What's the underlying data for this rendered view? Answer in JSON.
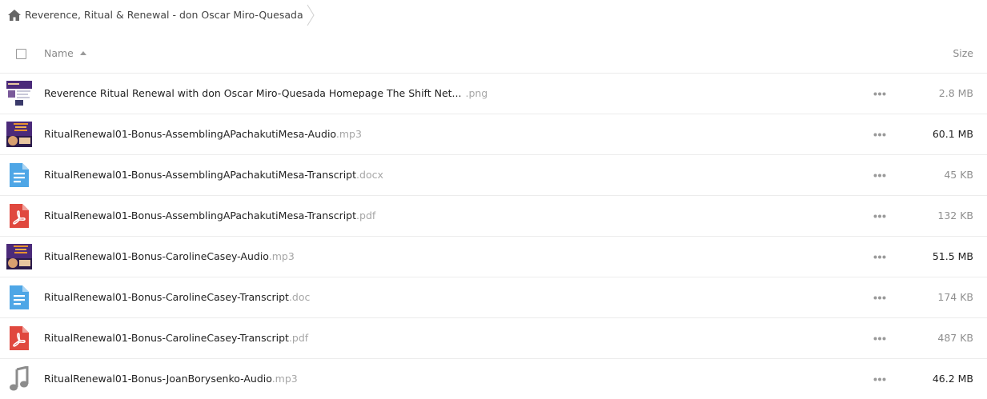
{
  "breadcrumb": {
    "folder_name": "Reverence, Ritual & Renewal - don Oscar Miro-Quesada"
  },
  "header": {
    "name_label": "Name",
    "size_label": "Size"
  },
  "files": [
    {
      "name": "Reverence Ritual Renewal with don Oscar Miro-Quesada Homepage The Shift Net...",
      "ext": ".png",
      "size": "2.8 MB",
      "icon": "image-thumbnail",
      "size_emphasis": false
    },
    {
      "name": "RitualRenewal01-Bonus-AssemblingAPachakutiMesa-Audio",
      "ext": ".mp3",
      "size": "60.1 MB",
      "icon": "audio-cover-thumbnail",
      "size_emphasis": true
    },
    {
      "name": "RitualRenewal01-Bonus-AssemblingAPachakutiMesa-Transcript",
      "ext": ".docx",
      "size": "45 KB",
      "icon": "document-icon",
      "size_emphasis": false
    },
    {
      "name": "RitualRenewal01-Bonus-AssemblingAPachakutiMesa-Transcript",
      "ext": ".pdf",
      "size": "132 KB",
      "icon": "pdf-icon",
      "size_emphasis": false
    },
    {
      "name": "RitualRenewal01-Bonus-CarolineCasey-Audio",
      "ext": ".mp3",
      "size": "51.5 MB",
      "icon": "audio-cover-thumbnail",
      "size_emphasis": true
    },
    {
      "name": "RitualRenewal01-Bonus-CarolineCasey-Transcript",
      "ext": ".doc",
      "size": "174 KB",
      "icon": "document-icon",
      "size_emphasis": false
    },
    {
      "name": "RitualRenewal01-Bonus-CarolineCasey-Transcript",
      "ext": ".pdf",
      "size": "487 KB",
      "icon": "pdf-icon",
      "size_emphasis": false
    },
    {
      "name": "RitualRenewal01-Bonus-JoanBorysenko-Audio",
      "ext": ".mp3",
      "size": "46.2 MB",
      "icon": "music-note-icon",
      "size_emphasis": true
    }
  ],
  "colors": {
    "doc_blue": "#4ea6e6",
    "pdf_red": "#e0483e",
    "audio_grey": "#8c8c8c",
    "cover_purple": "#4b2a7a",
    "cover_orange": "#e8922e"
  }
}
